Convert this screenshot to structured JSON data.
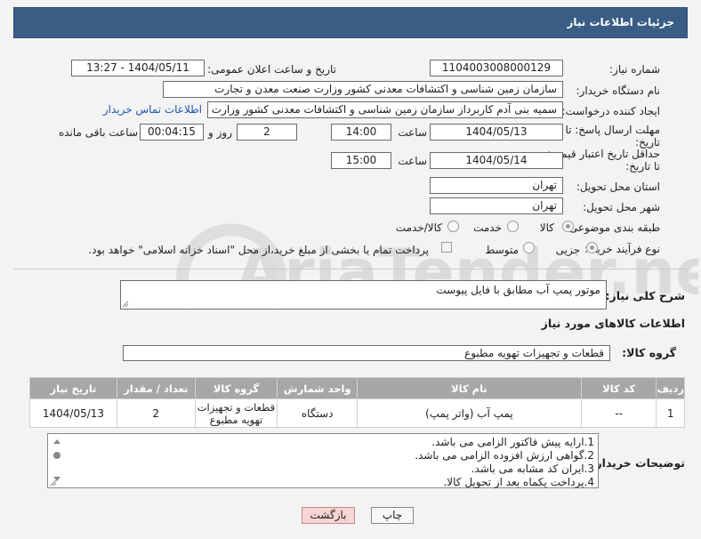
{
  "header": {
    "title": "جزئیات اطلاعات نیاز"
  },
  "fields": {
    "need_number_label": "شماره نیاز:",
    "need_number": "1104003008000129",
    "announce_label": "تاریخ و ساعت اعلان عمومی:",
    "announce_value": "1404/05/11 - 13:27",
    "buyer_org_label": "نام دستگاه خریدار:",
    "buyer_org": "سازمان زمین شناسی و اکتشافات معدنی کشور وزارت صنعت معدن و تجارت",
    "creator_label": "ایجاد کننده درخواست:",
    "creator": "سمیه بنی آدم کاربرداز سازمان زمین شناسی و اکتشافات معدنی کشور وزارت د",
    "contact_link": "اطلاعات تماس خریدار",
    "deadline_label": "مهلت ارسال پاسخ: تا",
    "deadline_label2": "تاریخ:",
    "deadline_date": "1404/05/13",
    "time_label": "ساعت",
    "deadline_time": "14:00",
    "days_value": "2",
    "days_label": "روز و",
    "remaining_value": "00:04:15",
    "remaining_label": "ساعت باقی مانده",
    "validity_label": "حداقل تاریخ اعتبار قیمت:",
    "validity_label2": "تا تاریخ:",
    "validity_date": "1404/05/14",
    "validity_time": "15:00",
    "province_label": "استان محل تحویل:",
    "province": "تهران",
    "city_label": "شهر محل تحویل:",
    "city": "تهران",
    "category_label": "طبقه بندی موضوعی:",
    "category_options": [
      "کالا",
      "خدمت",
      "کالا/خدمت"
    ],
    "process_label": "نوع فرآیند خرید :",
    "process_options": [
      "جزیی",
      "متوسط"
    ],
    "payment_note": "پرداخت تمام یا بخشی از مبلغ خرید،از محل \"اسناد خزانه اسلامی\" خواهد بود."
  },
  "description": {
    "label": "شرح کلی نیاز:",
    "value": "موتور پمپ آب مطابق با فایل پیوست"
  },
  "goods": {
    "section_title": "اطلاعات کالاهای مورد نیاز",
    "group_label": "گروه کالا:",
    "group_value": "قطعات و تجهیزات تهویه مطبوع"
  },
  "table": {
    "headers": [
      "ردیف",
      "کد کالا",
      "نام کالا",
      "واحد شمارش",
      "گروه کالا",
      "تعداد / مقدار",
      "تاریخ نیاز"
    ],
    "rows": [
      [
        "1",
        "--",
        "پمپ آب (واتر پمپ)",
        "دستگاه",
        "قطعات و تجهیزات تهویه مطبوع",
        "2",
        "1404/05/13"
      ]
    ]
  },
  "buyer_notes": {
    "label": "توضیحات خریدار:",
    "lines": [
      "1.ارایه پیش فاکتور الزامی می باشد.",
      "2.گواهی ارزش افزوده الزامی می باشد.",
      "3.ایران کد مشابه می باشد.",
      "4.پرداخت یکماه بعد از تحویل کالا."
    ]
  },
  "buttons": {
    "print": "چاپ",
    "back": "بازگشت"
  },
  "watermark": {
    "text": "AriaTender.neT"
  }
}
